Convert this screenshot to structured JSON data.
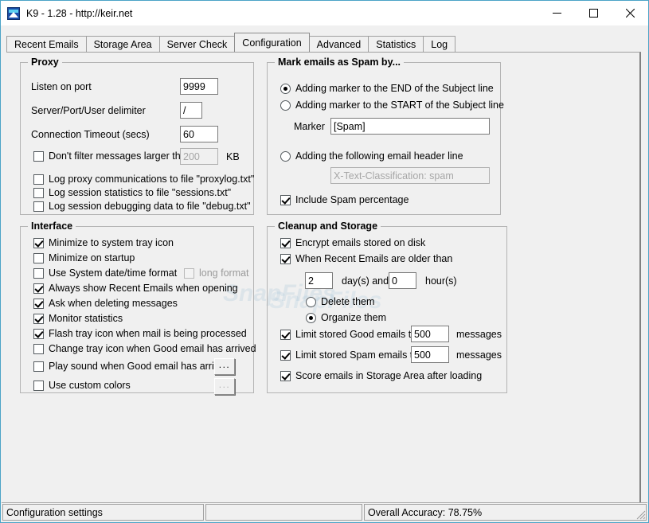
{
  "window": {
    "title": "K9 - 1.28 - http://keir.net",
    "icon": "k9-app-icon",
    "minimize_label": "Minimize",
    "maximize_label": "Maximize",
    "close_label": "Close",
    "watermark": "SnapFiles"
  },
  "tabs": [
    {
      "label": "Recent Emails",
      "active": false
    },
    {
      "label": "Storage Area",
      "active": false
    },
    {
      "label": "Server Check",
      "active": false
    },
    {
      "label": "Configuration",
      "active": true
    },
    {
      "label": "Advanced",
      "active": false
    },
    {
      "label": "Statistics",
      "active": false
    },
    {
      "label": "Log",
      "active": false
    }
  ],
  "proxy": {
    "legend": "Proxy",
    "listen_port_label": "Listen on port",
    "listen_port_value": "9999",
    "delimiter_label": "Server/Port/User delimiter",
    "delimiter_value": "/",
    "timeout_label": "Connection Timeout (secs)",
    "timeout_value": "60",
    "dont_filter_label": "Don't filter messages larger than",
    "dont_filter_checked": false,
    "dont_filter_value": "200",
    "dont_filter_unit": "KB",
    "log_proxy_label": "Log proxy communications to file \"proxylog.txt\"",
    "log_proxy_checked": false,
    "log_sessions_label": "Log session statistics to file \"sessions.txt\"",
    "log_sessions_checked": false,
    "log_debug_label": "Log session debugging data to file \"debug.txt\"",
    "log_debug_checked": false
  },
  "interface": {
    "legend": "Interface",
    "items": [
      {
        "label": "Minimize to system tray icon",
        "checked": true,
        "disabled": false
      },
      {
        "label": "Minimize on startup",
        "checked": false,
        "disabled": false
      },
      {
        "label": "Use System date/time format",
        "checked": false,
        "disabled": false
      },
      {
        "label": "long format",
        "checked": false,
        "disabled": true
      },
      {
        "label": "Always show Recent Emails when opening",
        "checked": true,
        "disabled": false
      },
      {
        "label": "Ask when deleting messages",
        "checked": true,
        "disabled": false
      },
      {
        "label": "Monitor statistics",
        "checked": true,
        "disabled": false
      },
      {
        "label": "Flash tray icon when mail is being processed",
        "checked": true,
        "disabled": false
      },
      {
        "label": "Change tray icon when Good email has arrived",
        "checked": false,
        "disabled": false
      },
      {
        "label": "Play sound when Good email has arrived",
        "checked": false,
        "disabled": false
      },
      {
        "label": "Use custom colors",
        "checked": false,
        "disabled": false
      }
    ],
    "browse_sound_label": "...",
    "browse_colors_label": "..."
  },
  "spam_marking": {
    "legend": "Mark emails as Spam by...",
    "option_end_label": "Adding marker to the END of the Subject line",
    "option_end_selected": true,
    "option_start_label": "Adding marker to the START of the Subject line",
    "option_start_selected": false,
    "marker_label": "Marker",
    "marker_value": "[Spam]",
    "option_header_label": "Adding the following email header line",
    "option_header_selected": false,
    "header_value": "X-Text-Classification: spam",
    "include_percentage_label": "Include Spam percentage",
    "include_percentage_checked": true
  },
  "cleanup": {
    "legend": "Cleanup and Storage",
    "encrypt_label": "Encrypt emails stored on disk",
    "encrypt_checked": true,
    "older_than_label": "When Recent Emails are older than",
    "older_than_checked": true,
    "days_value": "2",
    "days_unit": "day(s) and",
    "hours_value": "0",
    "hours_unit": "hour(s)",
    "delete_label": "Delete them",
    "delete_selected": false,
    "organize_label": "Organize them",
    "organize_selected": true,
    "limit_good_label": "Limit stored Good emails to",
    "limit_good_checked": true,
    "limit_good_value": "500",
    "limit_good_unit": "messages",
    "limit_spam_label": "Limit stored Spam emails to",
    "limit_spam_checked": true,
    "limit_spam_value": "500",
    "limit_spam_unit": "messages",
    "score_label": "Score emails in Storage Area after loading",
    "score_checked": true
  },
  "statusbar": {
    "left": "Configuration settings",
    "middle": "",
    "right": "Overall Accuracy: 78.75%"
  }
}
